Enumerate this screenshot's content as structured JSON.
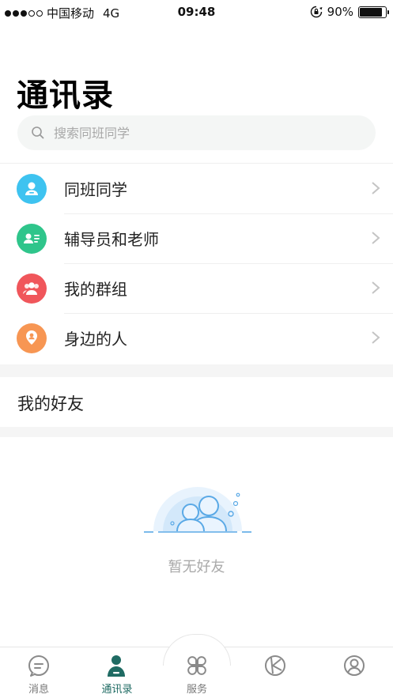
{
  "status_bar": {
    "carrier": "中国移动",
    "network": "4G",
    "time": "09:48",
    "battery": "90%"
  },
  "page": {
    "title": "通讯录"
  },
  "search": {
    "placeholder": "搜索同班同学"
  },
  "menu": [
    {
      "label": "同班同学",
      "icon": "classmate-icon",
      "color": "#3ec3f0"
    },
    {
      "label": "辅导员和老师",
      "icon": "teacher-card-icon",
      "color": "#2fc58b"
    },
    {
      "label": "我的群组",
      "icon": "group-icon",
      "color": "#f0565b"
    },
    {
      "label": "身边的人",
      "icon": "location-person-icon",
      "color": "#f79653"
    }
  ],
  "friends_section": {
    "title": "我的好友",
    "empty_text": "暂无好友"
  },
  "tabbar": {
    "items": [
      {
        "label": "消息",
        "icon": "message-icon"
      },
      {
        "label": "通讯录",
        "icon": "contacts-icon",
        "active": true
      },
      {
        "label": "服务",
        "icon": "services-icon"
      },
      {
        "label": "",
        "icon": "discover-icon"
      },
      {
        "label": "",
        "icon": "profile-icon"
      }
    ]
  },
  "colors": {
    "accent": "#1f6b63",
    "empty_illustration": "#5aa9e6"
  }
}
